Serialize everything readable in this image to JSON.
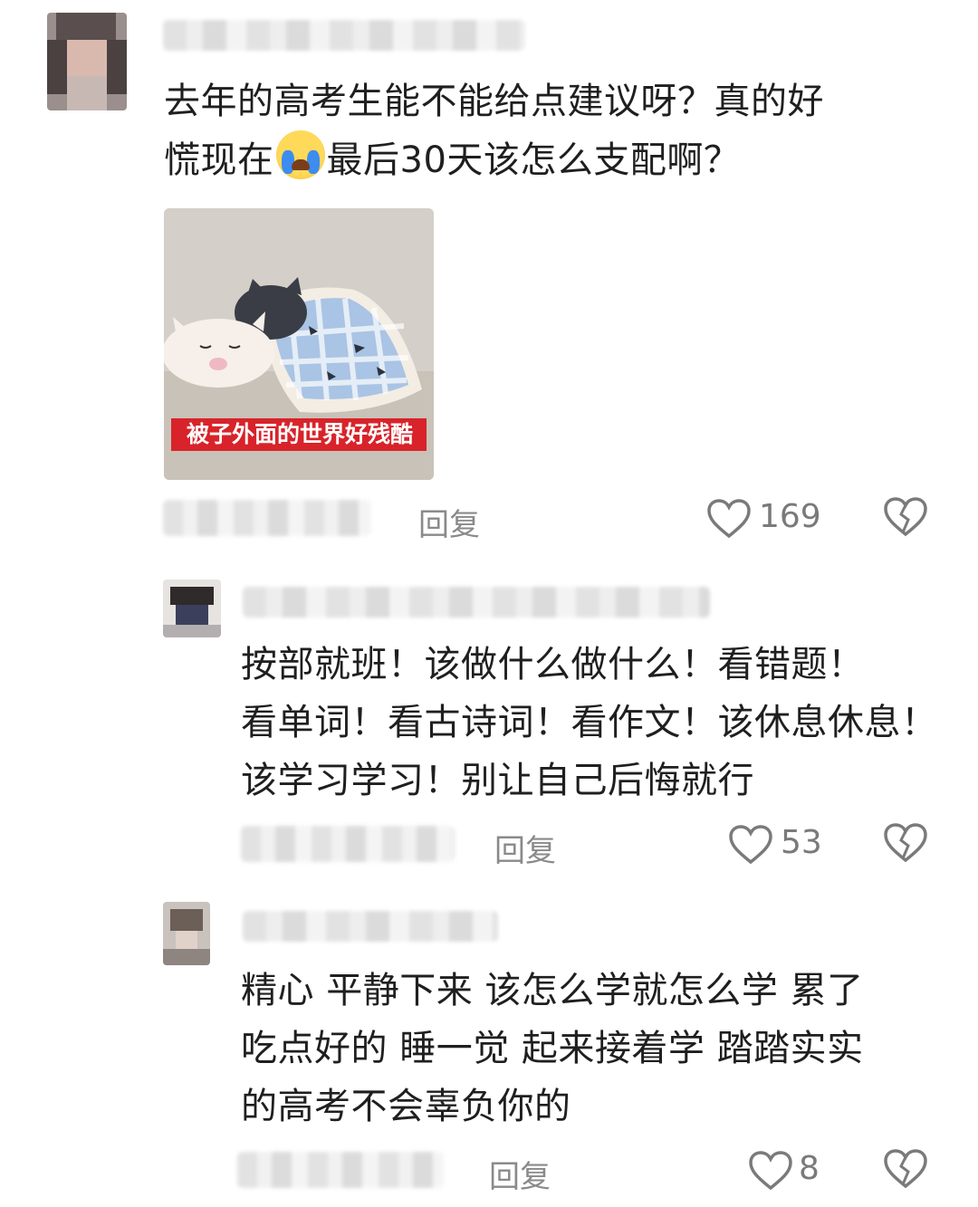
{
  "comments": [
    {
      "text_line1": "去年的高考生能不能给点建议呀？真的好",
      "text_line2_part1": "慌现在",
      "text_line2_part2": "最后30天该怎么支配啊？",
      "sticker_caption": "被子外面的世界好残酷",
      "reply_label": "回复",
      "likes": "169"
    },
    {
      "lines": [
        "按部就班！该做什么做什么！看错题！",
        "看单词！看古诗词！看作文！该休息休息！",
        "该学习学习！别让自己后悔就行"
      ],
      "reply_label": "回复",
      "likes": "53"
    },
    {
      "lines": [
        "精心 平静下来 该怎么学就怎么学 累了",
        "吃点好的 睡一觉 起来接着学 踏踏实实",
        "的高考不会辜负你的"
      ],
      "reply_label": "回复",
      "likes": "8"
    }
  ],
  "icons": {
    "like": "heart-outline-icon",
    "dislike": "broken-heart-icon",
    "emoji": "crying-face-emoji"
  },
  "colors": {
    "text": "#1f1f1f",
    "secondary": "#8a8a8a",
    "caption_bg": "#d8232a"
  }
}
